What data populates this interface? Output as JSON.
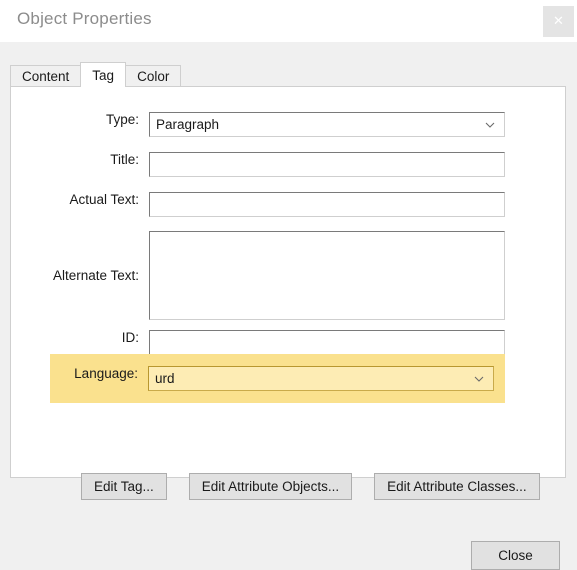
{
  "window": {
    "title": "Object Properties",
    "close_icon": "close-x-icon"
  },
  "tabs": [
    {
      "label": "Content",
      "selected": false
    },
    {
      "label": "Tag",
      "selected": true
    },
    {
      "label": "Color",
      "selected": false
    }
  ],
  "form": {
    "type": {
      "label": "Type:",
      "value": "Paragraph",
      "control": "combobox",
      "chevron_icon": "chevron-down-icon"
    },
    "title": {
      "label": "Title:",
      "value": "",
      "placeholder": ""
    },
    "actual_text": {
      "label": "Actual Text:",
      "value": "",
      "placeholder": ""
    },
    "alternate_text": {
      "label": "Alternate Text:",
      "value": "",
      "placeholder": ""
    },
    "id": {
      "label": "ID:",
      "value": "",
      "placeholder": ""
    },
    "language": {
      "label": "Language:",
      "value": "urd",
      "control": "combobox",
      "chevron_icon": "chevron-down-icon",
      "highlighted": true,
      "highlight_color": "#fae18e"
    }
  },
  "buttons": {
    "edit_tag": "Edit Tag...",
    "edit_attribute_objects": "Edit Attribute Objects...",
    "edit_attribute_classes": "Edit Attribute Classes...",
    "close": "Close"
  },
  "colors": {
    "dialog_background": "#f0f0f0",
    "panel_background": "#ffffff",
    "highlight_yellow": "#fae18e",
    "title_text": "#8c8c8c"
  }
}
